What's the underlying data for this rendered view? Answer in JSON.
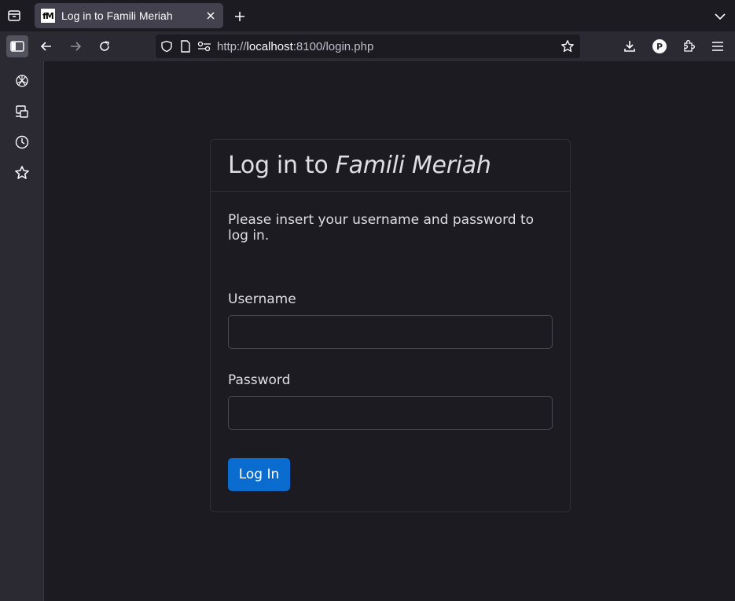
{
  "browser": {
    "tab": {
      "title": "Log in to Famili Meriah",
      "favicon_text": "fM"
    },
    "url": {
      "scheme": "http://",
      "host": "localhost",
      "rest": ":8100/login.php"
    },
    "profile_initial": "P"
  },
  "login": {
    "title_prefix": "Log in to ",
    "title_site": "Famili Meriah",
    "intro": "Please insert your username and password to log in.",
    "username_label": "Username",
    "username_value": "",
    "password_label": "Password",
    "password_value": "",
    "submit_label": "Log In"
  },
  "colors": {
    "accent": "#0b6ccf",
    "page_bg": "#1c1b22",
    "toolbar_bg": "#2b2a33"
  }
}
